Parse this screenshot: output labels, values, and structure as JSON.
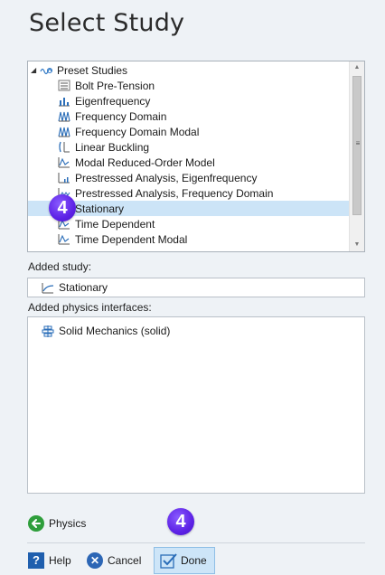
{
  "header": {
    "title": "Select Study"
  },
  "tree": {
    "root": {
      "label": "Preset Studies",
      "icon": "preset-studies-icon"
    },
    "items": [
      {
        "label": "Bolt Pre-Tension",
        "icon": "bolt-pretension-icon"
      },
      {
        "label": "Eigenfrequency",
        "icon": "eigenfrequency-icon"
      },
      {
        "label": "Frequency Domain",
        "icon": "frequency-domain-icon"
      },
      {
        "label": "Frequency Domain Modal",
        "icon": "frequency-domain-modal-icon"
      },
      {
        "label": "Linear Buckling",
        "icon": "linear-buckling-icon"
      },
      {
        "label": "Modal Reduced-Order Model",
        "icon": "modal-rom-icon"
      },
      {
        "label": "Prestressed Analysis, Eigenfrequency",
        "icon": "prestressed-eigen-icon"
      },
      {
        "label": "Prestressed Analysis, Frequency Domain",
        "icon": "prestressed-freq-icon"
      },
      {
        "label": "Stationary",
        "icon": "stationary-icon",
        "selected": true
      },
      {
        "label": "Time Dependent",
        "icon": "time-dependent-icon"
      },
      {
        "label": "Time Dependent Modal",
        "icon": "time-dependent-modal-icon"
      }
    ]
  },
  "added_study": {
    "label": "Added study:",
    "value": "Stationary"
  },
  "added_physics": {
    "label": "Added physics interfaces:",
    "items": [
      "Solid Mechanics (solid)"
    ]
  },
  "badges": {
    "study_step": "4",
    "done_step": "4"
  },
  "nav": {
    "physics_label": "Physics"
  },
  "buttons": {
    "help": "Help",
    "help_glyph": "?",
    "cancel": "Cancel",
    "done": "Done"
  },
  "colors": {
    "selection": "#cce4f7",
    "badge": "#5d22e6",
    "accent_blue": "#1f5fae",
    "green": "#2e9e3b"
  }
}
